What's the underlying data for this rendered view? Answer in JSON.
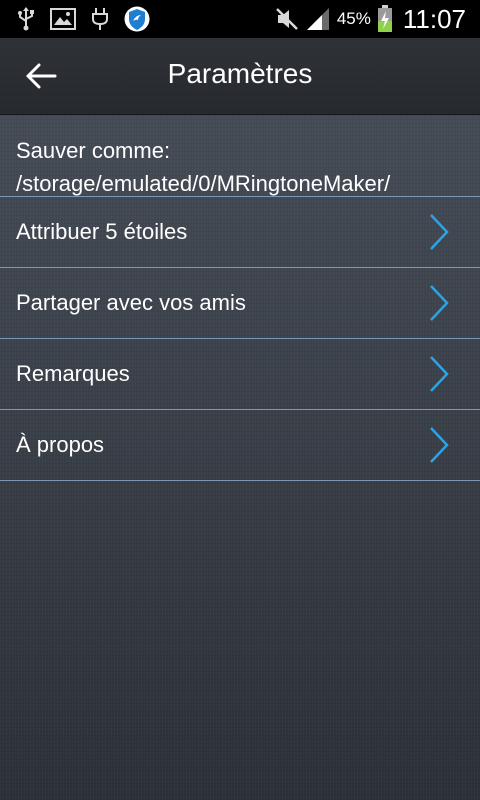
{
  "status_bar": {
    "icons": [
      "usb-icon",
      "image-icon",
      "charging-plug-icon",
      "shield-app-icon"
    ],
    "mute_icon": "mute-icon",
    "signal_icon": "signal-icon",
    "battery_percent": "45%",
    "battery_level": 0.45,
    "time": "11:07"
  },
  "header": {
    "back_icon": "back-arrow-icon",
    "title": "Paramètres"
  },
  "settings": {
    "save_as_label": "Sauver comme:",
    "save_path": "/storage/emulated/0/MRingtoneMaker/",
    "items": [
      {
        "label": "Attribuer 5 étoiles"
      },
      {
        "label": "Partager avec vos amis"
      },
      {
        "label": "Remarques"
      },
      {
        "label": "À propos"
      }
    ]
  },
  "colors": {
    "accent_chevron": "#2ba3e6",
    "divider": "#7a97b8",
    "battery_fill": "#8fd14a"
  }
}
